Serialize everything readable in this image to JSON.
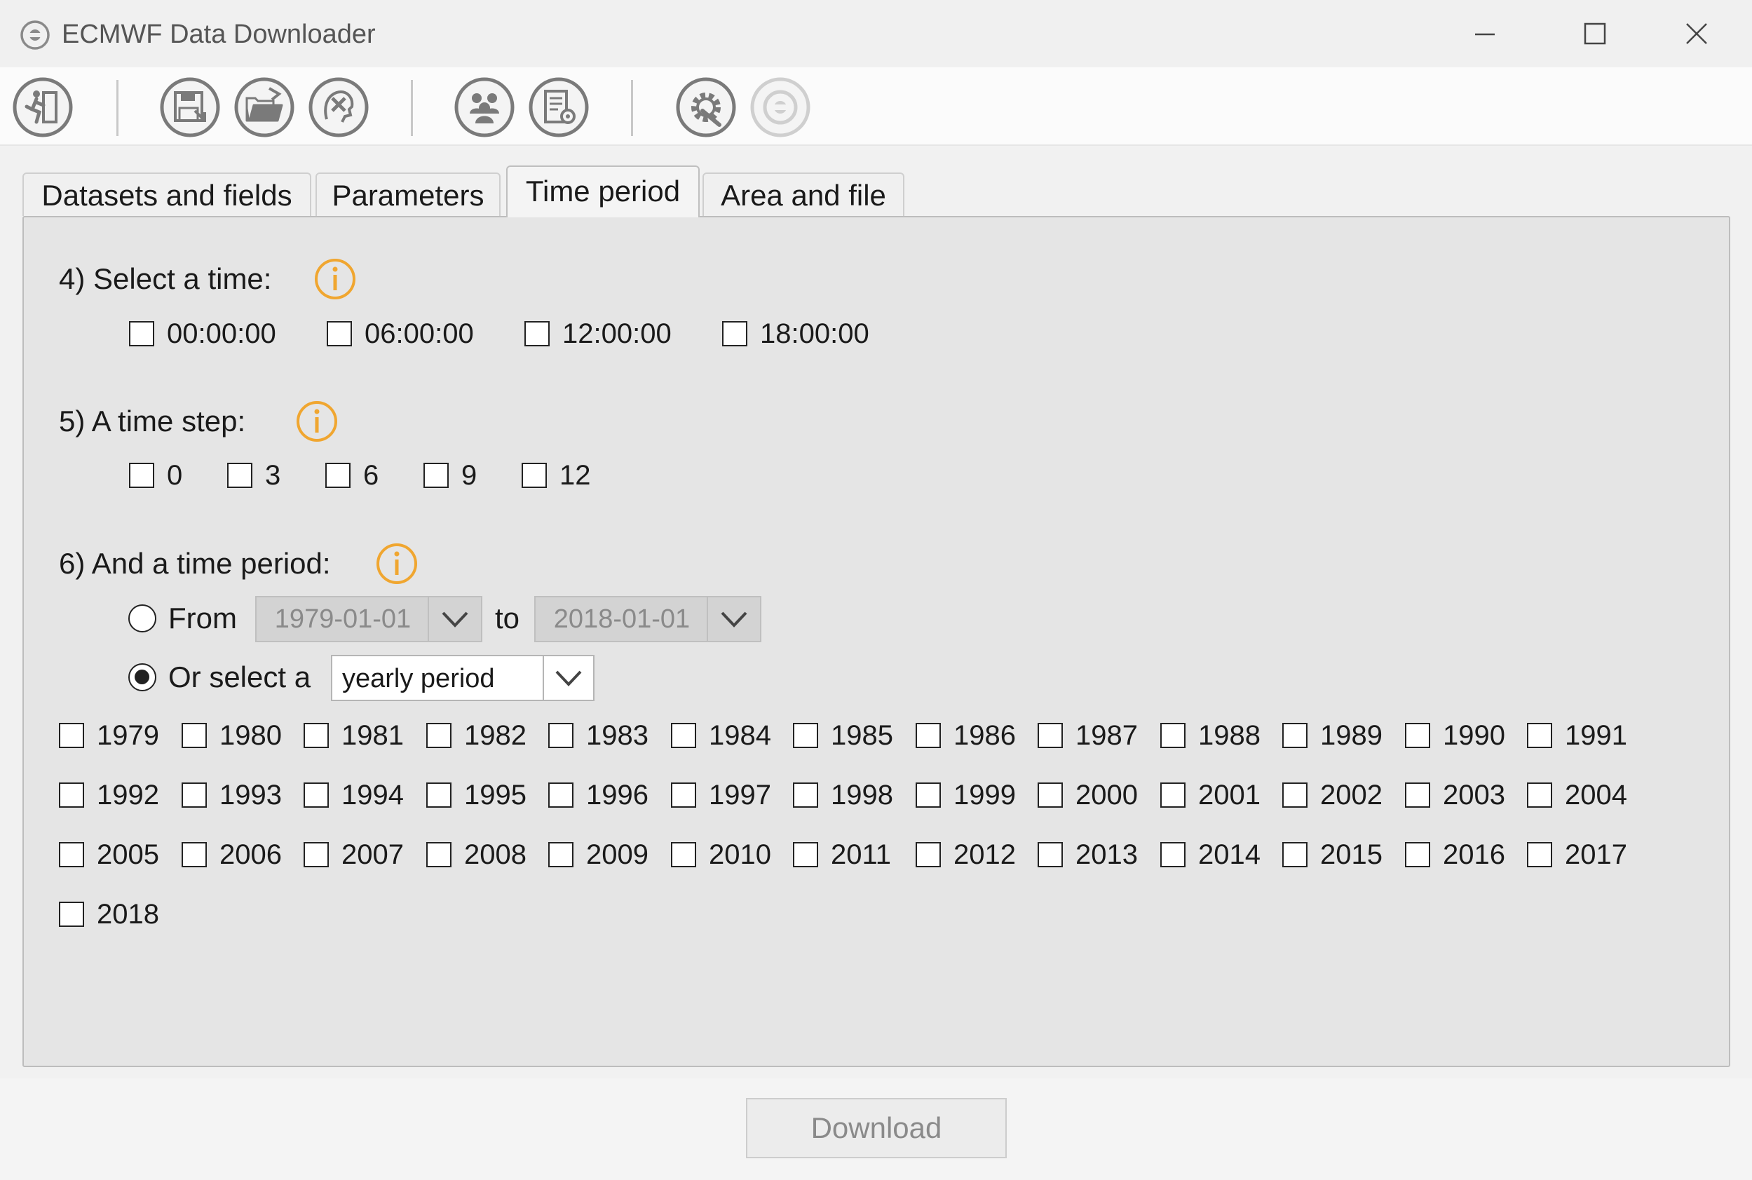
{
  "window": {
    "title": "ECMWF Data Downloader"
  },
  "toolbar": {
    "buttons": [
      "exit-icon",
      "save-icon",
      "open-folder-icon",
      "clear-settings-icon",
      "users-icon",
      "report-settings-icon",
      "settings-gear-icon",
      "help-icon"
    ]
  },
  "tabs": [
    {
      "label": "Datasets and fields",
      "active": false
    },
    {
      "label": "Parameters",
      "active": false
    },
    {
      "label": "Time period",
      "active": true
    },
    {
      "label": "Area and file",
      "active": false
    }
  ],
  "time_section": {
    "label": "4) Select a time:",
    "options": [
      "00:00:00",
      "06:00:00",
      "12:00:00",
      "18:00:00"
    ]
  },
  "step_section": {
    "label": "5) A time step:",
    "options": [
      "0",
      "3",
      "6",
      "9",
      "12"
    ]
  },
  "period_section": {
    "label": "6) And a time period:",
    "from_label": "From",
    "from_value": "1979-01-01",
    "to_label": "to",
    "to_value": "2018-01-01",
    "or_select_label": "Or select a",
    "select_value": "yearly period",
    "selected_mode": "yearly period",
    "years": [
      "1979",
      "1980",
      "1981",
      "1982",
      "1983",
      "1984",
      "1985",
      "1986",
      "1987",
      "1988",
      "1989",
      "1990",
      "1991",
      "1992",
      "1993",
      "1994",
      "1995",
      "1996",
      "1997",
      "1998",
      "1999",
      "2000",
      "2001",
      "2002",
      "2003",
      "2004",
      "2005",
      "2006",
      "2007",
      "2008",
      "2009",
      "2010",
      "2011",
      "2012",
      "2013",
      "2014",
      "2015",
      "2016",
      "2017",
      "2018"
    ]
  },
  "download": {
    "label": "Download"
  },
  "colors": {
    "info_icon": "#f0a630",
    "icon_gray": "#707070"
  }
}
